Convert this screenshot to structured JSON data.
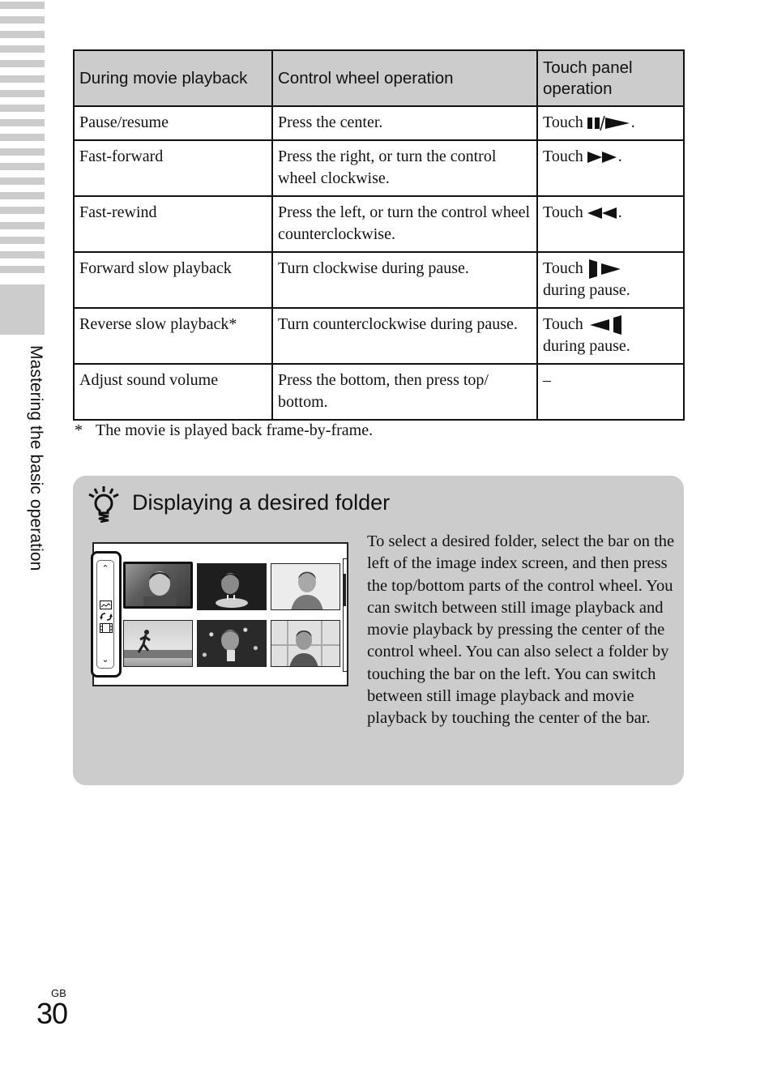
{
  "side_tab": {
    "label": "Mastering the basic operation"
  },
  "table": {
    "headers": [
      "During movie playback",
      "Control wheel operation",
      "Touch panel operation"
    ],
    "rows": [
      {
        "action": "Pause/resume",
        "wheel": "Press the center.",
        "touch_prefix": "Touch",
        "touch_icon": "pause-play-icon",
        "touch_suffix": ".",
        "touch_second_line": ""
      },
      {
        "action": "Fast-forward",
        "wheel": "Press the right, or turn the control wheel clockwise.",
        "touch_prefix": "Touch",
        "touch_icon": "fast-forward-icon",
        "touch_suffix": ".",
        "touch_second_line": ""
      },
      {
        "action": "Fast-rewind",
        "wheel": "Press the left, or turn the control wheel counterclockwise.",
        "touch_prefix": "Touch",
        "touch_icon": "fast-rewind-icon",
        "touch_suffix": ".",
        "touch_second_line": ""
      },
      {
        "action": "Forward slow playback",
        "wheel": "Turn clockwise during pause.",
        "touch_prefix": "Touch",
        "touch_icon": "slow-forward-icon",
        "touch_suffix": "",
        "touch_second_line": "during pause."
      },
      {
        "action": "Reverse slow playback*",
        "wheel": "Turn counterclockwise during pause.",
        "touch_prefix": "Touch",
        "touch_icon": "slow-reverse-icon",
        "touch_suffix": "",
        "touch_second_line": "during pause."
      },
      {
        "action": "Adjust sound volume",
        "wheel": "Press the bottom, then press top/ bottom.",
        "touch_prefix": "–",
        "touch_icon": "",
        "touch_suffix": "",
        "touch_second_line": ""
      }
    ]
  },
  "footnote": {
    "mark": "*",
    "text": "The movie is played back frame-by-frame."
  },
  "tip": {
    "icon": "hint-lightbulb-icon",
    "title": "Displaying a desired folder",
    "body": "To select a desired folder, select the bar on the left of the image index screen, and then press the top/bottom parts of the control wheel. You can switch between still image playback and movie playback by pressing the center of the control wheel. You can also select a folder by touching the bar on the left. You can switch between still image playback and movie playback by touching the center of the bar.",
    "screen": {
      "folder_bar_icons": [
        "still-image-icon",
        "switch-icon",
        "movie-icon"
      ],
      "up_glyph": "⌃",
      "down_glyph": "⌄",
      "thumbnails": [
        {
          "name": "boy-portrait-outdoor",
          "selected": true
        },
        {
          "name": "girl-birthday-cake",
          "selected": false
        },
        {
          "name": "boy-portrait-white",
          "selected": false
        },
        {
          "name": "runner-beach",
          "selected": false
        },
        {
          "name": "boy-bokeh-lights",
          "selected": false
        },
        {
          "name": "boy-window",
          "selected": false
        }
      ]
    }
  },
  "page": {
    "lang": "GB",
    "number": "30"
  },
  "colors": {
    "tab_gray": "#cccccc",
    "tip_bg": "#cccccc",
    "text": "#111111"
  }
}
